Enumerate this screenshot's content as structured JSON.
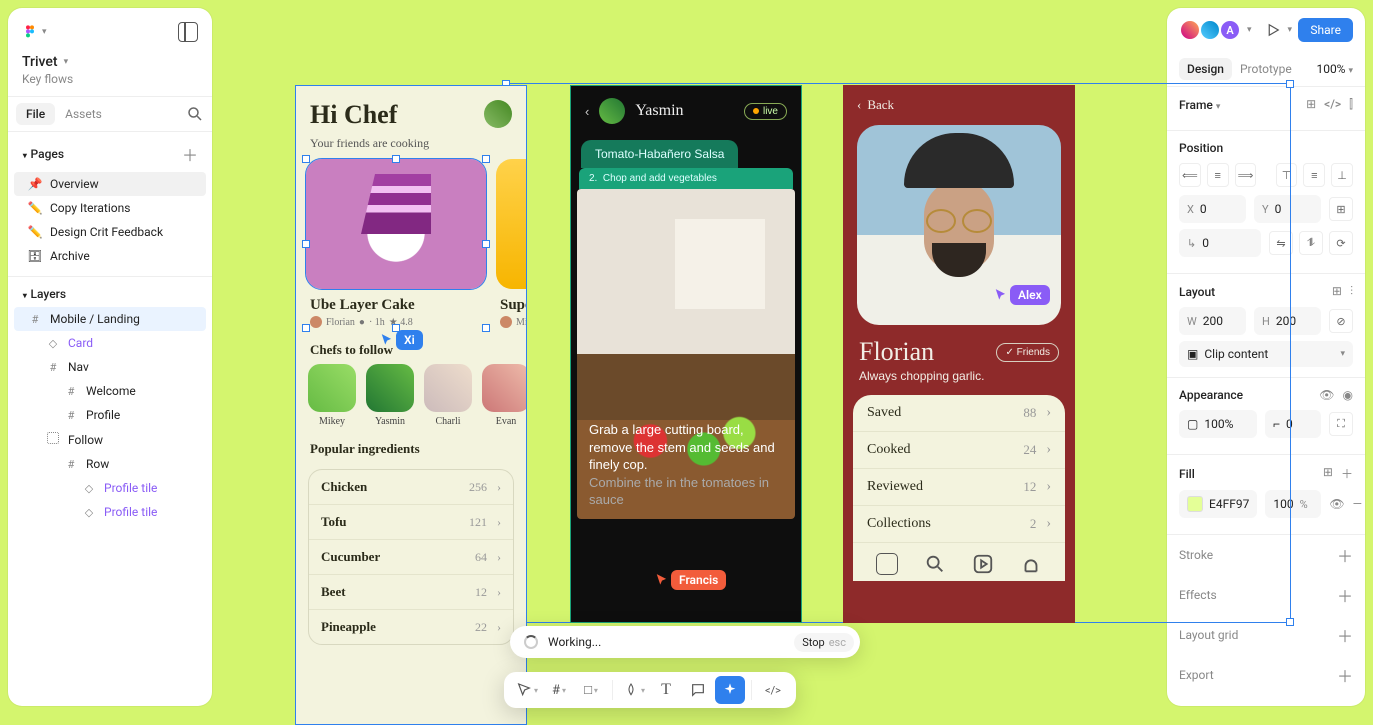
{
  "left": {
    "title": "Trivet",
    "subtitle": "Key flows",
    "tabs": {
      "file": "File",
      "assets": "Assets"
    },
    "pages_label": "Pages",
    "pages": [
      {
        "icon": "📌",
        "label": "Overview"
      },
      {
        "icon": "✏️",
        "label": "Copy Iterations"
      },
      {
        "icon": "✏️",
        "label": "Design Crit Feedback"
      },
      {
        "icon": "🗄",
        "label": "Archive"
      }
    ],
    "layers_label": "Layers",
    "layers": {
      "root": "Mobile / Landing",
      "card": "Card",
      "nav": "Nav",
      "welcome": "Welcome",
      "profile": "Profile",
      "follow": "Follow",
      "row": "Row",
      "tile": "Profile tile"
    }
  },
  "right": {
    "avatar_letter": "A",
    "share": "Share",
    "tabs": {
      "design": "Design",
      "prototype": "Prototype"
    },
    "zoom": "100%",
    "frame_label": "Frame",
    "position_label": "Position",
    "x_label": "X",
    "x_val": "0",
    "y_label": "Y",
    "y_val": "0",
    "r_label": "↳",
    "r_val": "0",
    "layout_label": "Layout",
    "w_label": "W",
    "w_val": "200",
    "h_label": "H",
    "h_val": "200",
    "clip_label": "Clip content",
    "appearance_label": "Appearance",
    "opacity_label": "100%",
    "angle_val": "0",
    "fill_label": "Fill",
    "fill_hex": "E4FF97",
    "fill_pct": "100",
    "fill_pct_unit": "%",
    "stroke_label": "Stroke",
    "effects_label": "Effects",
    "grid_label": "Layout grid",
    "export_label": "Export"
  },
  "phone1": {
    "hi": "Hi Chef",
    "sub": "Your friends are cooking",
    "card1_title": "Ube Layer Cake",
    "card1_by": "Florian",
    "card1_time": "· 1h",
    "card1_rating": "★ 4.8",
    "card2_title": "Super",
    "card2_by": "Mia",
    "chefs_h": "Chefs to follow",
    "chefs": [
      "Mikey",
      "Yasmin",
      "Charli",
      "Evan"
    ],
    "ing_h": "Popular ingredients",
    "ings": [
      {
        "n": "Chicken",
        "c": "256"
      },
      {
        "n": "Tofu",
        "c": "121"
      },
      {
        "n": "Cucumber",
        "c": "64"
      },
      {
        "n": "Beet",
        "c": "12"
      },
      {
        "n": "Pineapple",
        "c": "22"
      }
    ]
  },
  "phone2": {
    "name": "Yasmin",
    "live": "live",
    "tab": "Tomato-Habañero Salsa",
    "step_n": "2.",
    "step": "Chop and add vegetables",
    "cap1": "Grab a large cutting board, remove the stem and seeds and finely c",
    "cap1b": "op.",
    "cap2": "Combine the ",
    "cap2b": " in the tomatoes in sauce"
  },
  "phone3": {
    "back": "Back",
    "name": "Florian",
    "friends": "✓ Friends",
    "bio": "Always chopping garlic.",
    "stats": [
      {
        "n": "Saved",
        "c": "88"
      },
      {
        "n": "Cooked",
        "c": "24"
      },
      {
        "n": "Reviewed",
        "c": "12"
      },
      {
        "n": "Collections",
        "c": "2"
      }
    ]
  },
  "cursors": {
    "xi": "Xi",
    "alex": "Alex",
    "francis": "Francis"
  },
  "working": {
    "label": "Working...",
    "stop": "Stop",
    "esc": "esc"
  }
}
